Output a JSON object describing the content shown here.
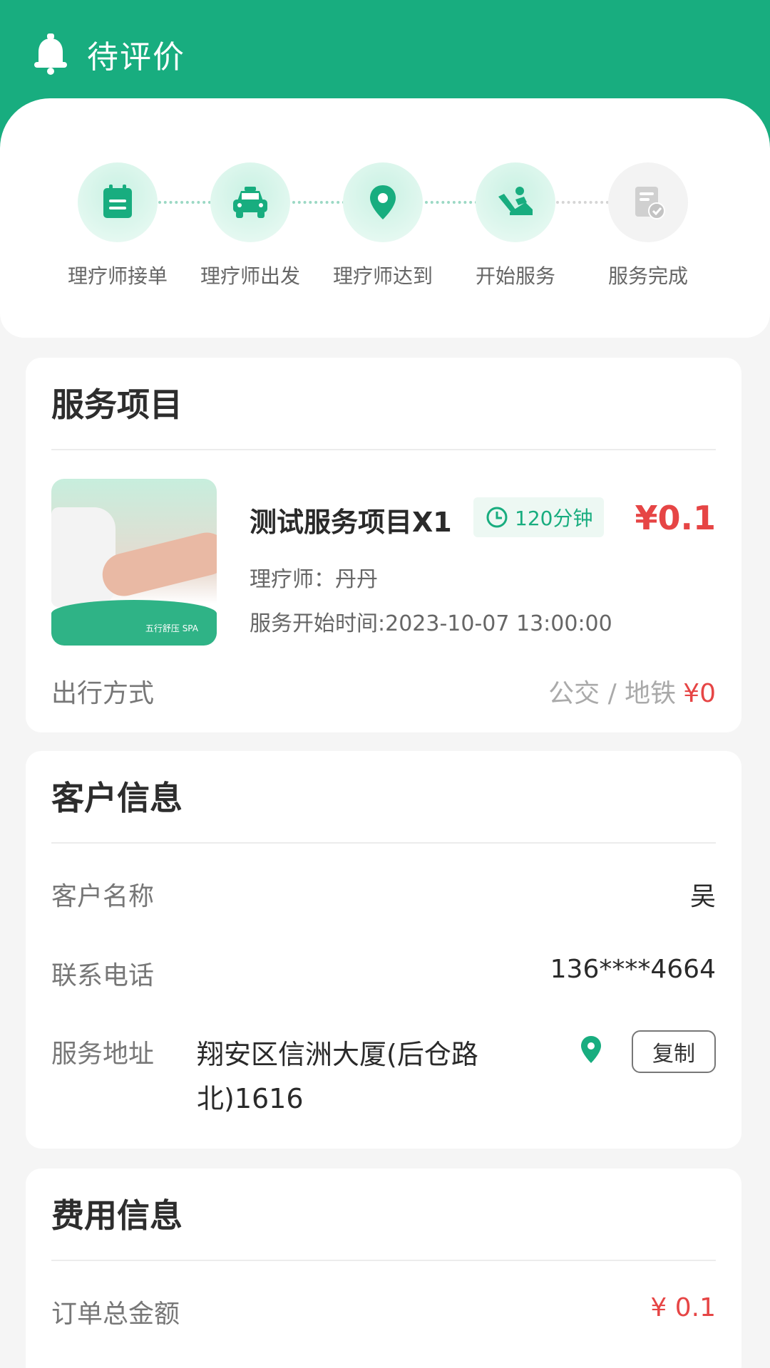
{
  "header": {
    "title": "待评价"
  },
  "steps": [
    {
      "label": "理疗师接单",
      "icon": "calendar-icon",
      "done": true
    },
    {
      "label": "理疗师出发",
      "icon": "car-icon",
      "done": true
    },
    {
      "label": "理疗师达到",
      "icon": "location-pin-icon",
      "done": true
    },
    {
      "label": "开始服务",
      "icon": "massage-service-icon",
      "done": true
    },
    {
      "label": "服务完成",
      "icon": "document-check-icon",
      "done": false
    }
  ],
  "service": {
    "section_title": "服务项目",
    "name": "测试服务项目X1",
    "duration": "120分钟",
    "price": "¥0.1",
    "therapist": "理疗师：丹丹",
    "start_time": "服务开始时间:2023-10-07 13:00:00",
    "image_brand_text": "五行舒压 SPA",
    "travel_label": "出行方式",
    "travel_mode": "公交 / 地铁",
    "travel_fee": "¥0"
  },
  "customer": {
    "section_title": "客户信息",
    "name_label": "客户名称",
    "name_value": "吴",
    "phone_label": "联系电话",
    "phone_value": "136****4664",
    "address_label": "服务地址",
    "address_value": "翔安区信洲大厦(后仓路北)1616",
    "copy_label": "复制"
  },
  "fees": {
    "section_title": "费用信息",
    "total_label": "订单总金额",
    "total_value": "¥ 0.1"
  },
  "colors": {
    "accent": "#18ad7f",
    "price": "#e64545"
  }
}
